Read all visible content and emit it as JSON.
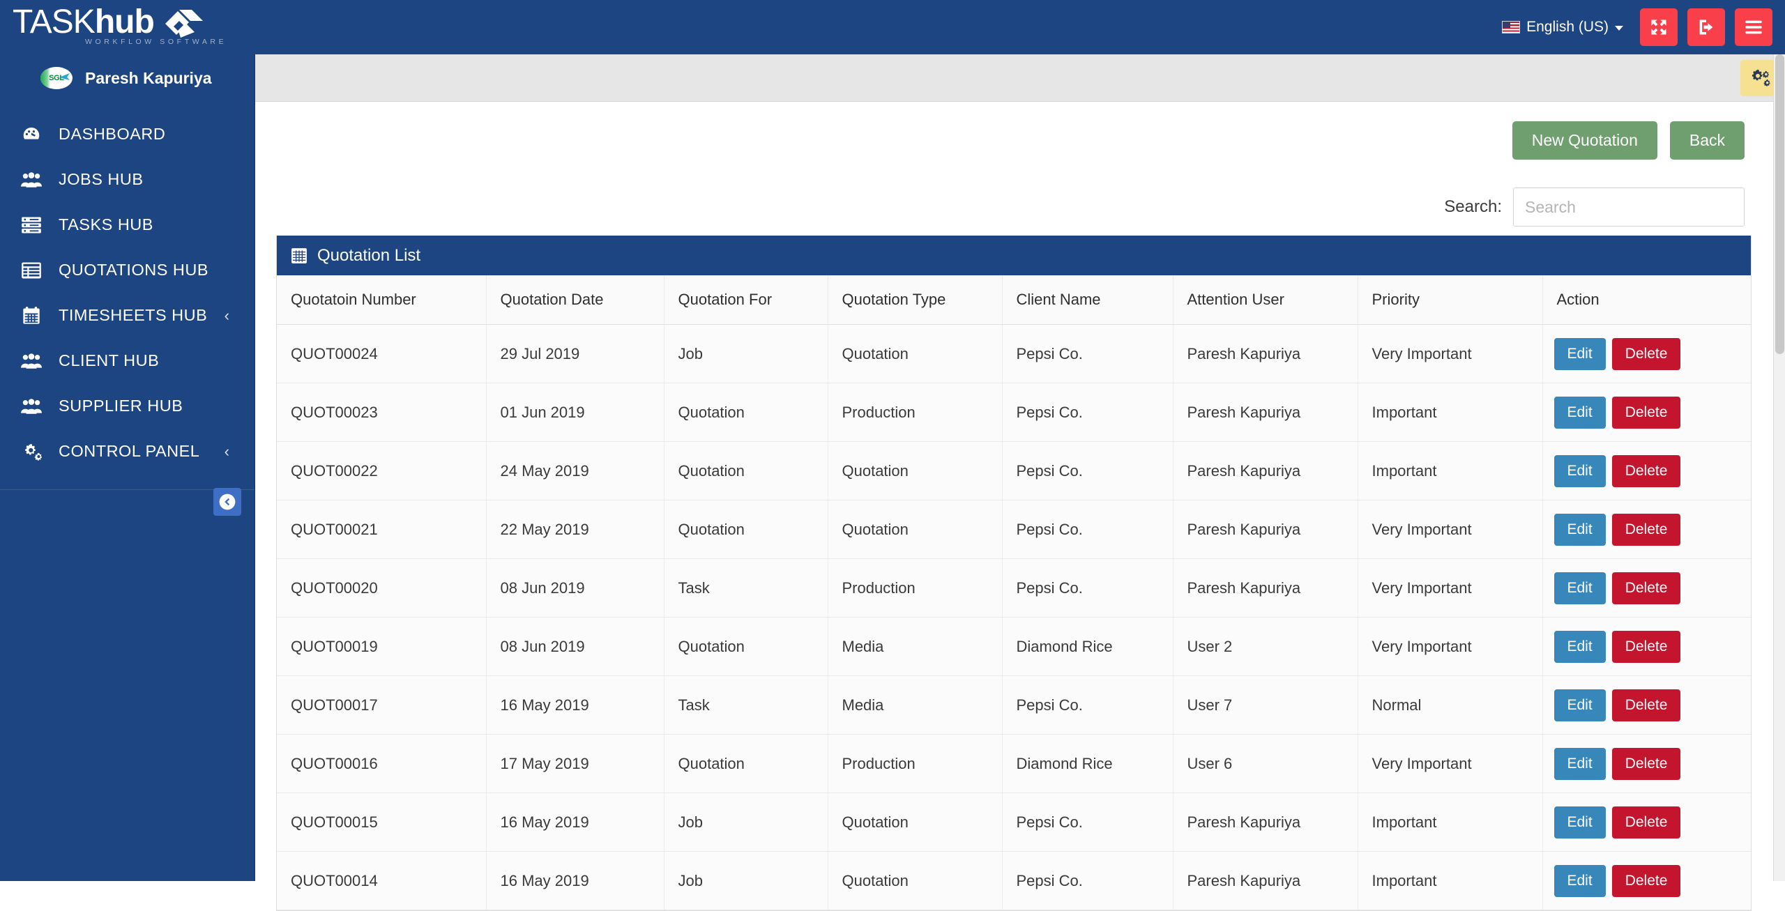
{
  "brand": {
    "name_light": "TASK",
    "name_bold": "hub",
    "tagline": "WORKFLOW SOFTWARE",
    "logo_icon": "cube-logo-icon",
    "color": "#1c4581"
  },
  "topbar": {
    "language": {
      "label": "English (US)",
      "flag_icon": "us-flag-icon",
      "chevron_icon": "chevron-down-icon"
    },
    "buttons": [
      {
        "name": "fullscreen-button",
        "icon": "expand-arrows-icon"
      },
      {
        "name": "logout-button",
        "icon": "sign-out-icon"
      },
      {
        "name": "menu-toggle-button",
        "icon": "hamburger-icon"
      }
    ],
    "accent_color": "#f9404a"
  },
  "sidebar": {
    "profile": {
      "name": "Paresh Kapuriya",
      "avatar_icon": "sgl-avatar-icon",
      "avatar_text": "SGL"
    },
    "items": [
      {
        "label": "DASHBOARD",
        "icon": "dashboard-gauge-icon",
        "caret": ""
      },
      {
        "label": "JOBS HUB",
        "icon": "users-group-icon",
        "caret": ""
      },
      {
        "label": "TASKS HUB",
        "icon": "server-list-icon",
        "caret": ""
      },
      {
        "label": "QUOTATIONS HUB",
        "icon": "table-list-icon",
        "caret": ""
      },
      {
        "label": "TIMESHEETS HUB",
        "icon": "calendar-icon",
        "caret": "‹"
      },
      {
        "label": "CLIENT HUB",
        "icon": "users-group-icon",
        "caret": ""
      },
      {
        "label": "SUPPLIER HUB",
        "icon": "users-group-icon",
        "caret": ""
      },
      {
        "label": "CONTROL PANEL",
        "icon": "gears-icon",
        "caret": "‹"
      }
    ],
    "collapse_button": {
      "name": "sidebar-collapse-button",
      "icon": "arrow-circle-left-icon"
    }
  },
  "content_header": {
    "settings_button": {
      "icon": "gears-icon",
      "bg": "#f6e193"
    }
  },
  "toolbar": {
    "new_quotation_label": "New Quotation",
    "back_label": "Back",
    "button_color": "#6f9e6f"
  },
  "search": {
    "label": "Search:",
    "placeholder": "Search",
    "value": ""
  },
  "panel": {
    "title": "Quotation List",
    "title_icon": "table-grid-icon",
    "header_color": "#1c4581"
  },
  "table": {
    "columns": [
      "Quotatoin Number",
      "Quotation Date",
      "Quotation For",
      "Quotation Type",
      "Client Name",
      "Attention User",
      "Priority",
      "Action"
    ],
    "action_labels": {
      "edit": "Edit",
      "delete": "Delete"
    },
    "action_colors": {
      "edit": "#3787ba",
      "delete": "#c3162e"
    },
    "rows": [
      {
        "number": "QUOT00024",
        "date": "29 Jul 2019",
        "for": "Job",
        "type": "Quotation",
        "client": "Pepsi Co.",
        "user": "Paresh Kapuriya",
        "priority": "Very Important"
      },
      {
        "number": "QUOT00023",
        "date": "01 Jun 2019",
        "for": "Quotation",
        "type": "Production",
        "client": "Pepsi Co.",
        "user": "Paresh Kapuriya",
        "priority": "Important"
      },
      {
        "number": "QUOT00022",
        "date": "24 May 2019",
        "for": "Quotation",
        "type": "Quotation",
        "client": "Pepsi Co.",
        "user": "Paresh Kapuriya",
        "priority": "Important"
      },
      {
        "number": "QUOT00021",
        "date": "22 May 2019",
        "for": "Quotation",
        "type": "Quotation",
        "client": "Pepsi Co.",
        "user": "Paresh Kapuriya",
        "priority": "Very Important"
      },
      {
        "number": "QUOT00020",
        "date": "08 Jun 2019",
        "for": "Task",
        "type": "Production",
        "client": "Pepsi Co.",
        "user": "Paresh Kapuriya",
        "priority": "Very Important"
      },
      {
        "number": "QUOT00019",
        "date": "08 Jun 2019",
        "for": "Quotation",
        "type": "Media",
        "client": "Diamond Rice",
        "user": "User 2",
        "priority": "Very Important"
      },
      {
        "number": "QUOT00017",
        "date": "16 May 2019",
        "for": "Task",
        "type": "Media",
        "client": "Pepsi Co.",
        "user": "User 7",
        "priority": "Normal"
      },
      {
        "number": "QUOT00016",
        "date": "17 May 2019",
        "for": "Quotation",
        "type": "Production",
        "client": "Diamond Rice",
        "user": "User 6",
        "priority": "Very Important"
      },
      {
        "number": "QUOT00015",
        "date": "16 May 2019",
        "for": "Job",
        "type": "Quotation",
        "client": "Pepsi Co.",
        "user": "Paresh Kapuriya",
        "priority": "Important"
      },
      {
        "number": "QUOT00014",
        "date": "16 May 2019",
        "for": "Job",
        "type": "Quotation",
        "client": "Pepsi Co.",
        "user": "Paresh Kapuriya",
        "priority": "Important"
      }
    ]
  }
}
